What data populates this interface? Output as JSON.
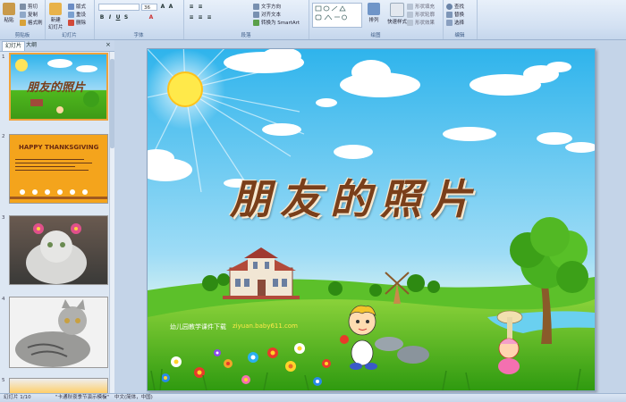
{
  "ribbon": {
    "clipboard": {
      "paste": "粘贴",
      "cut": "剪切",
      "copy": "复制",
      "format_painter": "格式刷",
      "label": "剪贴板"
    },
    "slides": {
      "new_slide": "新建\n幻灯片",
      "layout": "版式",
      "reset": "重设",
      "delete": "删除",
      "label": "幻灯片"
    },
    "font": {
      "size": "36",
      "label": "字体"
    },
    "paragraph": {
      "text_direction": "文字方向",
      "align_text": "对齐文本",
      "smartart": "转换为 SmartArt",
      "label": "段落"
    },
    "drawing": {
      "arrange": "排列",
      "quick_styles": "快速样式",
      "fill": "形状填充",
      "outline": "形状轮廓",
      "effects": "形状效果",
      "label": "绘图"
    },
    "editing": {
      "find": "查找",
      "replace": "替换",
      "select": "选择",
      "label": "编辑"
    }
  },
  "panel": {
    "tab_slides": "幻灯片",
    "tab_outline": "大纲",
    "slides": [
      {
        "num": "1",
        "title": "朋友的照片"
      },
      {
        "num": "2",
        "title": "HAPPY THANKSGIVING"
      },
      {
        "num": "3"
      },
      {
        "num": "4"
      },
      {
        "num": "5"
      }
    ]
  },
  "slide": {
    "title": "朋友的照片",
    "watermark_text": "幼儿园教学课件下载",
    "watermark_url": "ziyuan.baby611.com"
  },
  "status": {
    "slide_count": "幻灯片 1/10",
    "theme": "\"卡通秋夜季节演示模板\"",
    "language": "中文(简体，中国)"
  },
  "colors": {
    "title": "#7a3f1a",
    "sky_top": "#2fb4ec",
    "grass": "#4fb81e"
  }
}
